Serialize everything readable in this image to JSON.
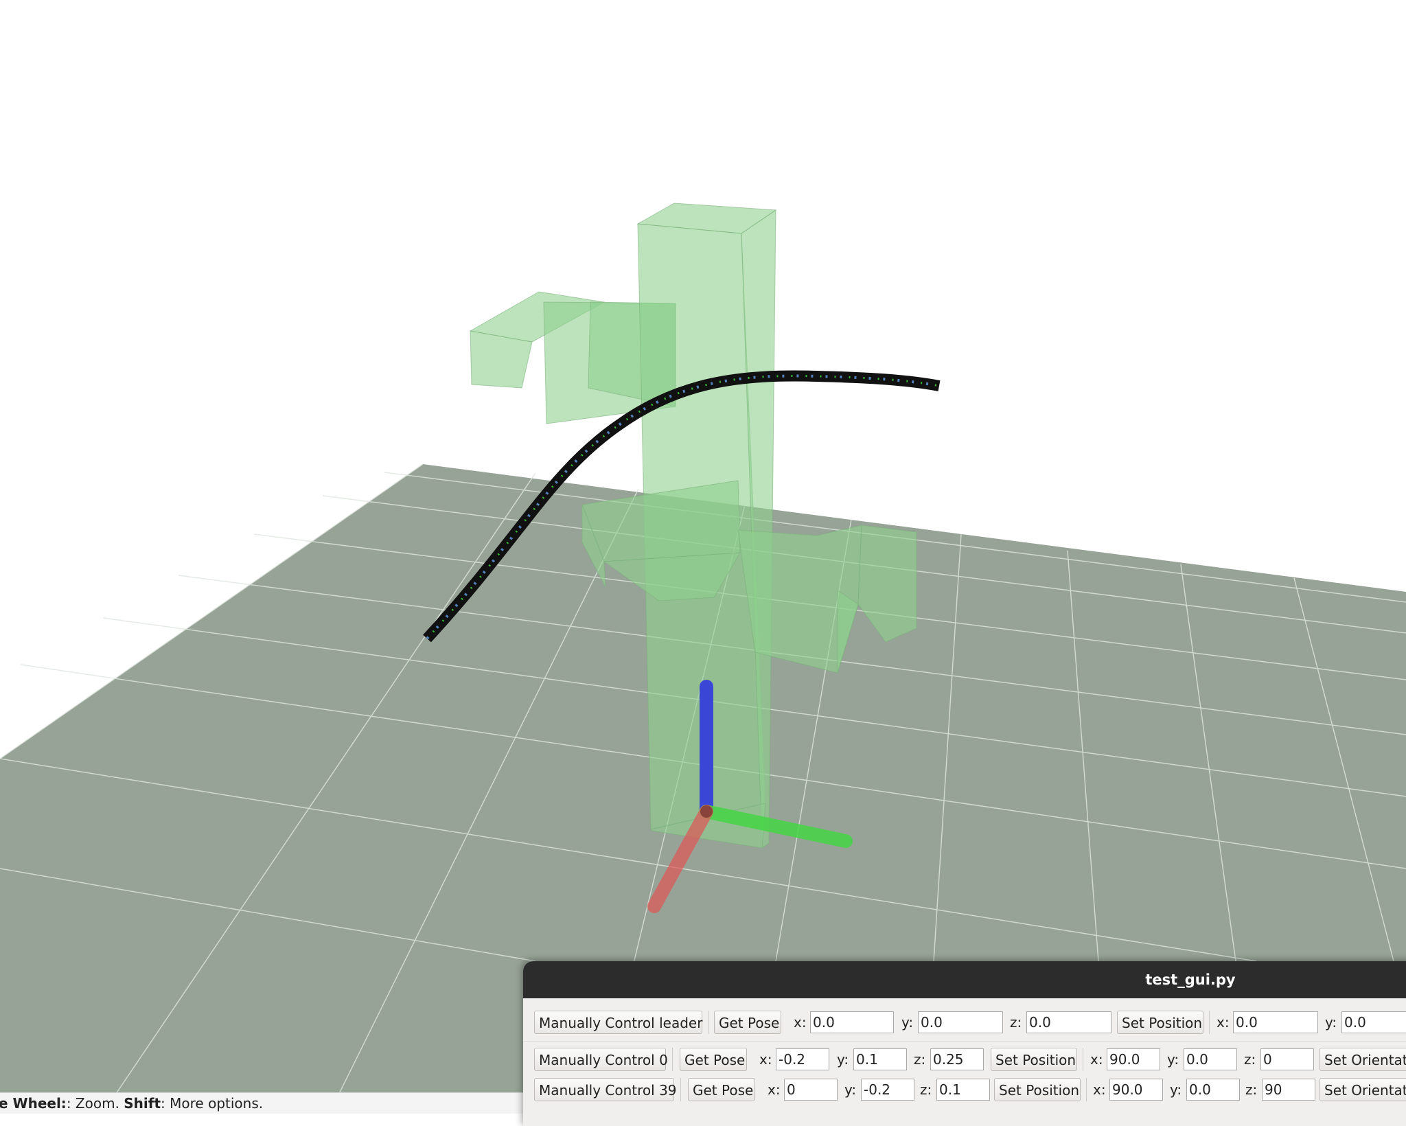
{
  "status_bar": {
    "wheel_key": "e Wheel:",
    "wheel_text": ": Zoom. ",
    "shift_key": "Shift",
    "shift_text": ": More options."
  },
  "gui_window": {
    "title": "test_gui.py",
    "rows": [
      {
        "control_label": "Manually Control leader",
        "get_pose_label": "Get Pose",
        "position": {
          "x": "0.0",
          "y": "0.0",
          "z": "0.0"
        },
        "set_position_label": "Set Position",
        "orientation": {
          "x": "0.0",
          "y": "0.0"
        }
      },
      {
        "control_label": "Manually Control 0",
        "get_pose_label": "Get Pose",
        "position": {
          "x": "-0.2",
          "y": "0.1",
          "z": "0.25"
        },
        "set_position_label": "Set Position",
        "orientation": {
          "x": "90.0",
          "y": "0.0",
          "z": "0"
        },
        "set_orientation_label": "Set Orientat"
      },
      {
        "control_label": "Manually Control 39",
        "get_pose_label": "Get Pose",
        "position": {
          "x": "0",
          "y": "-0.2",
          "z": "0.1"
        },
        "set_position_label": "Set Position",
        "orientation": {
          "x": "90.0",
          "y": "0.0",
          "z": "90"
        },
        "set_orientation_label": "Set Orientat"
      }
    ],
    "axis_labels": {
      "x": "x:",
      "y": "y:",
      "z": "z:"
    }
  },
  "scene": {
    "ground_color": "#97a397",
    "box_color": "#8fd18f",
    "rod_color": "#111111",
    "axis_colors": {
      "x": "#e05555",
      "y": "#44d644",
      "z": "#3a47d6"
    }
  }
}
